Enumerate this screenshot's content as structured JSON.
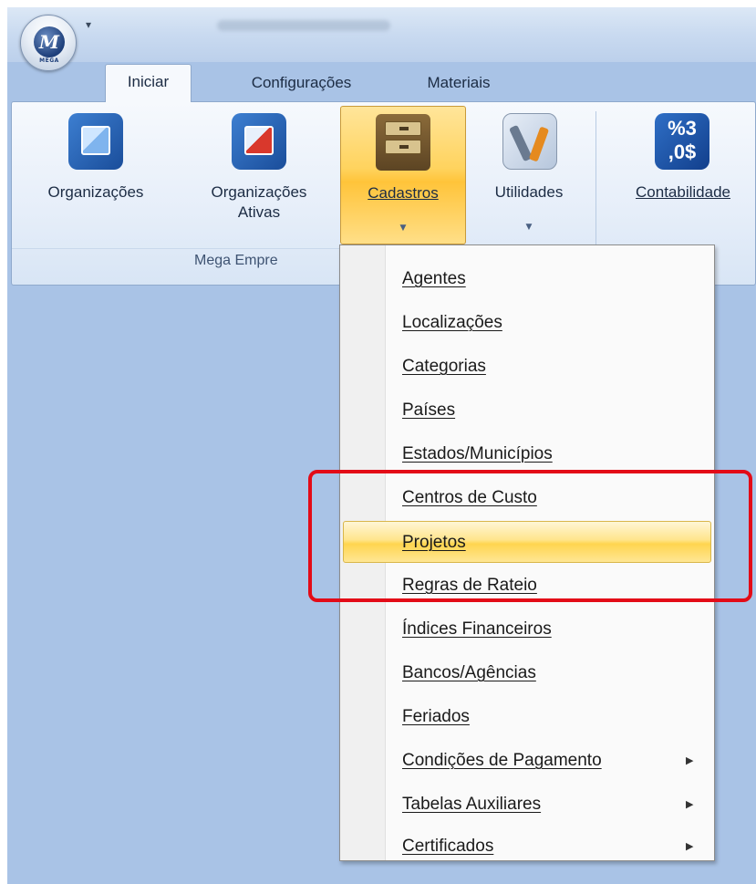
{
  "app": {
    "logo_text": "M",
    "logo_caption": "MEGA",
    "quick_access_symbol": "▾"
  },
  "tabs": [
    {
      "label": "Iniciar",
      "active": true
    },
    {
      "label": "Configurações",
      "active": false
    },
    {
      "label": "Materiais",
      "active": false
    }
  ],
  "ribbon": {
    "group_label": "Mega Empre",
    "buttons": {
      "organizacoes": {
        "label": "Organizações",
        "icon": "cube-icon"
      },
      "organizacoes_ativas": {
        "label_line1": "Organizações",
        "label_line2": "Ativas",
        "icon": "cube-red-icon"
      },
      "cadastros": {
        "label": "Cadastros",
        "dropdown_symbol": "▼",
        "icon": "file-cabinet-icon",
        "active": true
      },
      "utilidades": {
        "label": "Utilidades",
        "dropdown_symbol": "▼",
        "icon": "tools-icon"
      },
      "contabilidade": {
        "label": "Contabilidade",
        "icon_text": "%3 ,0$",
        "icon": "percent-money-icon"
      }
    }
  },
  "cadastros_menu": {
    "items": [
      {
        "label": "Agentes",
        "submenu": false
      },
      {
        "label": "Localizações",
        "submenu": false
      },
      {
        "label": "Categorias",
        "submenu": false
      },
      {
        "label": "Países",
        "submenu": false
      },
      {
        "label": "Estados/Municípios",
        "submenu": false
      },
      {
        "label": "Centros de Custo",
        "submenu": false
      },
      {
        "label": "Projetos",
        "submenu": false,
        "highlighted": true
      },
      {
        "label": "Regras de Rateio",
        "submenu": false
      },
      {
        "label": "Índices Financeiros",
        "submenu": false
      },
      {
        "label": "Bancos/Agências",
        "submenu": false
      },
      {
        "label": "Feriados",
        "submenu": false
      },
      {
        "label": "Condições de Pagamento",
        "submenu": true
      },
      {
        "label": "Tabelas Auxiliares",
        "submenu": true
      },
      {
        "label": "Certificados",
        "submenu": true
      }
    ],
    "submenu_arrow": "▶"
  },
  "colors": {
    "workspace": "#a9c3e6",
    "annotation_box": "#e30b17",
    "highlight": "#ffd54f"
  }
}
